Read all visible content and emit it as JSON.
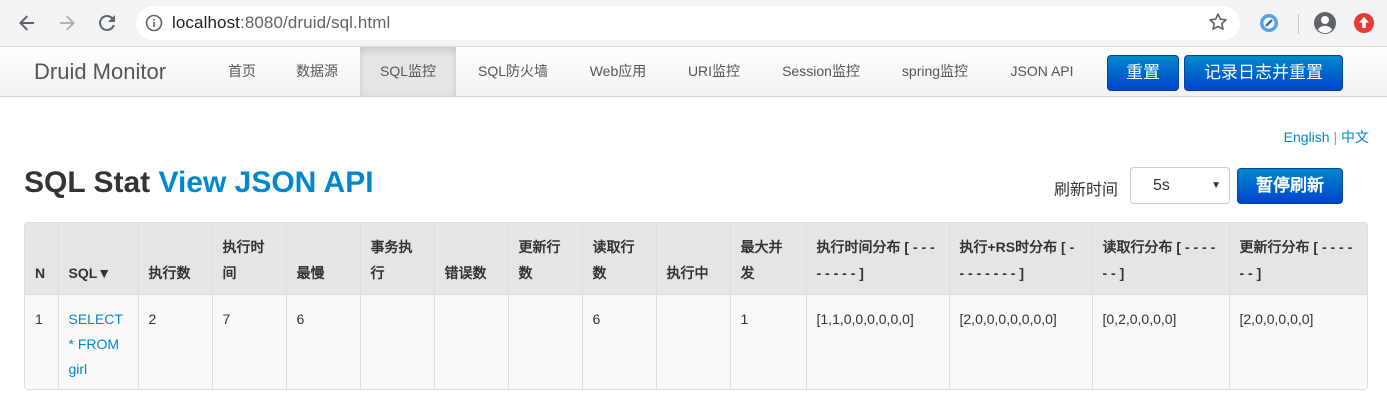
{
  "browser": {
    "url_host": "localhost",
    "url_rest": ":8080/druid/sql.html",
    "icons": {
      "back": "arrow-left-icon",
      "forward": "arrow-right-icon",
      "reload": "reload-icon",
      "info": "info-icon",
      "star": "star-icon",
      "account": "account-icon"
    }
  },
  "navbar": {
    "brand": "Druid Monitor",
    "items": [
      {
        "label": "首页"
      },
      {
        "label": "数据源"
      },
      {
        "label": "SQL监控"
      },
      {
        "label": "SQL防火墙"
      },
      {
        "label": "Web应用"
      },
      {
        "label": "URI监控"
      },
      {
        "label": "Session监控"
      },
      {
        "label": "spring监控"
      },
      {
        "label": "JSON API"
      }
    ],
    "active_index": 2,
    "reset_label": "重置",
    "log_reset_label": "记录日志并重置"
  },
  "lang": {
    "english": "English",
    "sep": "|",
    "chinese": "中文"
  },
  "page": {
    "title": "SQL Stat",
    "title_link": "View JSON API",
    "refresh_label": "刷新时间",
    "refresh_value": "5s",
    "pause_label": "暂停刷新"
  },
  "table": {
    "headers": [
      "N",
      "SQL▼",
      "执行数",
      "执行时间",
      "最慢",
      "事务执行",
      "错误数",
      "更新行数",
      "读取行数",
      "执行中",
      "最大并发",
      "执行时间分布 [ - - - - - - - - ]",
      "执行+RS时分布 [ - - - - - - - - ]",
      "读取行分布 [ - - - - - - ]",
      "更新行分布 [ - - - - - - ]"
    ],
    "rows": [
      [
        "1",
        "SELECT * FROM girl",
        "2",
        "7",
        "6",
        "",
        "",
        "",
        "6",
        "",
        "1",
        "[1,1,0,0,0,0,0,0]",
        "[2,0,0,0,0,0,0,0]",
        "[0,2,0,0,0,0]",
        "[2,0,0,0,0,0]"
      ]
    ]
  }
}
